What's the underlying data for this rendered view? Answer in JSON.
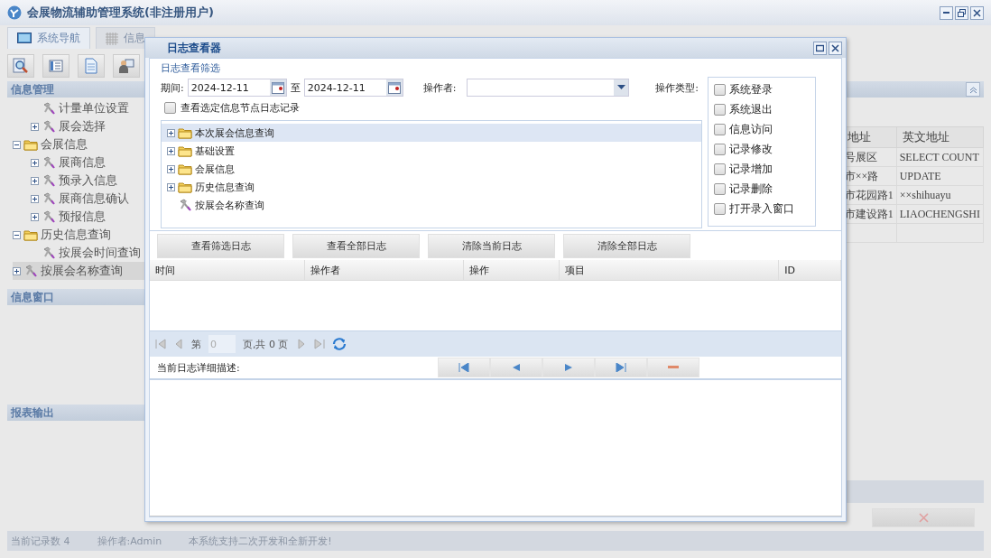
{
  "window": {
    "title": "会展物流辅助管理系统(非注册用户)"
  },
  "tabs": [
    {
      "label": "系统导航",
      "kind": "monitor",
      "selected": true
    },
    {
      "label": "信息",
      "kind": "grid",
      "selected": false
    }
  ],
  "toolbar": [
    {
      "kind": "search"
    },
    {
      "kind": "list"
    },
    {
      "kind": "document"
    },
    {
      "kind": "user"
    }
  ],
  "sidebar": {
    "title": "信息管理",
    "tree_continued": [
      {
        "label": "计量单位设置",
        "kind": "tool",
        "selected": false
      },
      {
        "label": "展会选择",
        "kind": "tool",
        "expanded": false,
        "selected": false
      }
    ],
    "tree": [
      {
        "label": "会展信息",
        "kind": "folder",
        "expanded": true,
        "selected": false,
        "children": [
          {
            "label": "展商信息",
            "kind": "tool",
            "expanded": false,
            "selected": false
          },
          {
            "label": "预录入信息",
            "kind": "tool",
            "expanded": false,
            "selected": false
          },
          {
            "label": "展商信息确认",
            "kind": "tool",
            "expanded": false,
            "selected": false
          },
          {
            "label": "预报信息",
            "kind": "tool",
            "expanded": false,
            "selected": false
          }
        ]
      },
      {
        "label": "历史信息查询",
        "kind": "folder",
        "expanded": true,
        "selected": false,
        "children": [
          {
            "label": "按展会时间查询",
            "kind": "tool",
            "selected": false
          }
        ]
      },
      {
        "label": "按展会名称查询",
        "kind": "tool",
        "expanded": false,
        "selected": true
      }
    ],
    "sections": [
      "信息窗口",
      "报表输出"
    ]
  },
  "table": {
    "columns": [
      "地址",
      "英文地址"
    ],
    "rows": [
      [
        "号展区",
        "SELECT COUNT"
      ],
      [
        "市××路",
        "UPDATE"
      ],
      [
        "市花园路1",
        "××shihuayu"
      ],
      [
        "市建设路1",
        "LIAOCHENGSHI"
      ]
    ]
  },
  "status_bar": [
    "当前记录数 4",
    "操作者:Admin",
    "本系统支持二次开发和全新开发!"
  ],
  "dialog": {
    "title": "日志查看器",
    "filter": {
      "legend": "日志查看筛选",
      "period_label": "期间:",
      "date_from": "2024-12-11",
      "to_label": "至",
      "date_to": "2024-12-11",
      "operator_label": "操作者:",
      "type_label": "操作类型:",
      "node_checkbox": {
        "label": "查看选定信息节点日志记录",
        "checked": false
      },
      "types": [
        {
          "label": "系统登录",
          "checked": false
        },
        {
          "label": "系统退出",
          "checked": false
        },
        {
          "label": "信息访问",
          "checked": false
        },
        {
          "label": "记录修改",
          "checked": false
        },
        {
          "label": "记录增加",
          "checked": false
        },
        {
          "label": "记录删除",
          "checked": false
        },
        {
          "label": "打开录入窗口",
          "checked": false
        }
      ]
    },
    "tree": [
      {
        "label": "本次展会信息查询",
        "kind": "folder",
        "expanded": false,
        "selected": true
      },
      {
        "label": "基础设置",
        "kind": "folder",
        "expanded": false,
        "selected": false
      },
      {
        "label": "会展信息",
        "kind": "folder",
        "expanded": false,
        "selected": false
      },
      {
        "label": "历史信息查询",
        "kind": "folder",
        "expanded": false,
        "selected": false
      },
      {
        "label": "按展会名称查询",
        "kind": "tool",
        "selected": false
      }
    ],
    "buttons": [
      "查看筛选日志",
      "查看全部日志",
      "清除当前日志",
      "清除全部日志"
    ],
    "grid": {
      "columns": [
        "时间",
        "操作者",
        "操作",
        "项目",
        "ID"
      ]
    },
    "pager": {
      "page_label": "第",
      "page_value": "0",
      "total_label": "页,共 0 页"
    },
    "detail": {
      "label": "当前日志详细描述:"
    }
  }
}
